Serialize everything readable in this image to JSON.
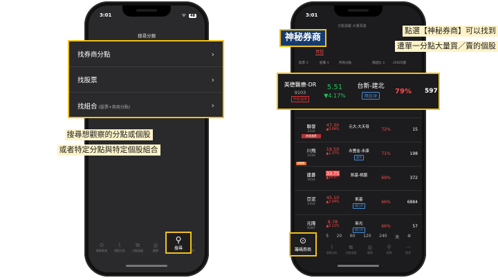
{
  "phone1": {
    "time": "3:01",
    "battery": "48",
    "title": "搜尋分類",
    "menu": [
      {
        "label": "找券商分點",
        "sub": ""
      },
      {
        "label": "找股票",
        "sub": ""
      },
      {
        "label": "找組合",
        "sub": "(股票+券商分點)"
      }
    ],
    "tabs": [
      "籌碼券商",
      "個股分析",
      "分點追蹤",
      "觀察",
      "搜尋",
      "更多"
    ],
    "active_tab": "搜尋",
    "callout_lines": [
      "搜尋想觀察的分點或個股",
      "或者特定分點與特定個股組合"
    ]
  },
  "phone2": {
    "time": "3:01",
    "topnav": "分點追蹤  大量買進",
    "subtab_active": "買超",
    "headers": [
      "股票 ⇕",
      "股價 ⇕",
      "券商分點",
      "買超比 ⇕",
      "20日均量"
    ],
    "highlight_row": {
      "stock": "美德醫療-DR",
      "code": "9103",
      "badge": "昨收漲停",
      "price": "5.51",
      "change": "▼4.17%",
      "broker": "台新-建北",
      "flag": "隔日沖",
      "pct": "79%",
      "vol": "597"
    },
    "rows": [
      {
        "tag": "",
        "stock": "聯發",
        "code": "3332",
        "badge": "昨收漲停",
        "price": "47.30",
        "change": "▲0.64%",
        "price_boxed": false,
        "broker": "元大-大天母",
        "flag": "",
        "pct": "72%",
        "vol": "15"
      },
      {
        "tag": "",
        "stock": "川飛",
        "code": "1516",
        "badge": "",
        "price": "18.50",
        "change": "▲1.37%",
        "price_boxed": false,
        "broker": "永豐金-永康",
        "flag": "當沖",
        "pct": "71%",
        "vol": "198"
      },
      {
        "tag": "處置股",
        "stock": "建碁",
        "code": "5014",
        "badge": "",
        "price": "33.75",
        "change": "▲10.0...",
        "price_boxed": true,
        "broker": "凱基-桃園",
        "flag": "",
        "pct": "69%",
        "vol": "372"
      },
      {
        "tag": "",
        "stock": "亞泥",
        "code": "1102",
        "badge": "",
        "price": "45.10",
        "change": "▲2.04%",
        "price_boxed": false,
        "broker": "凱基",
        "flag": "隔日沖",
        "pct": "66%",
        "vol": "6884"
      },
      {
        "tag": "",
        "stock": "元隆",
        "code": "6287",
        "badge": "",
        "price": "8.78",
        "change": "▲0.11%",
        "price_boxed": false,
        "broker": "新光",
        "flag": "隔日沖",
        "pct": "66%",
        "vol": "57"
      }
    ],
    "ranges": [
      "1",
      "5",
      "20",
      "60",
      "120",
      "240",
      "天",
      "⚙"
    ],
    "tabs": [
      "個股分析",
      "分點追蹤",
      "觀察",
      "搜尋",
      "更多"
    ],
    "active_tab": "籌碼券商",
    "label_mystery": "神秘券商",
    "callout_lines": [
      "點選【神秘券商】可以找到",
      "遭單一分點大量買／賣的個股"
    ]
  }
}
